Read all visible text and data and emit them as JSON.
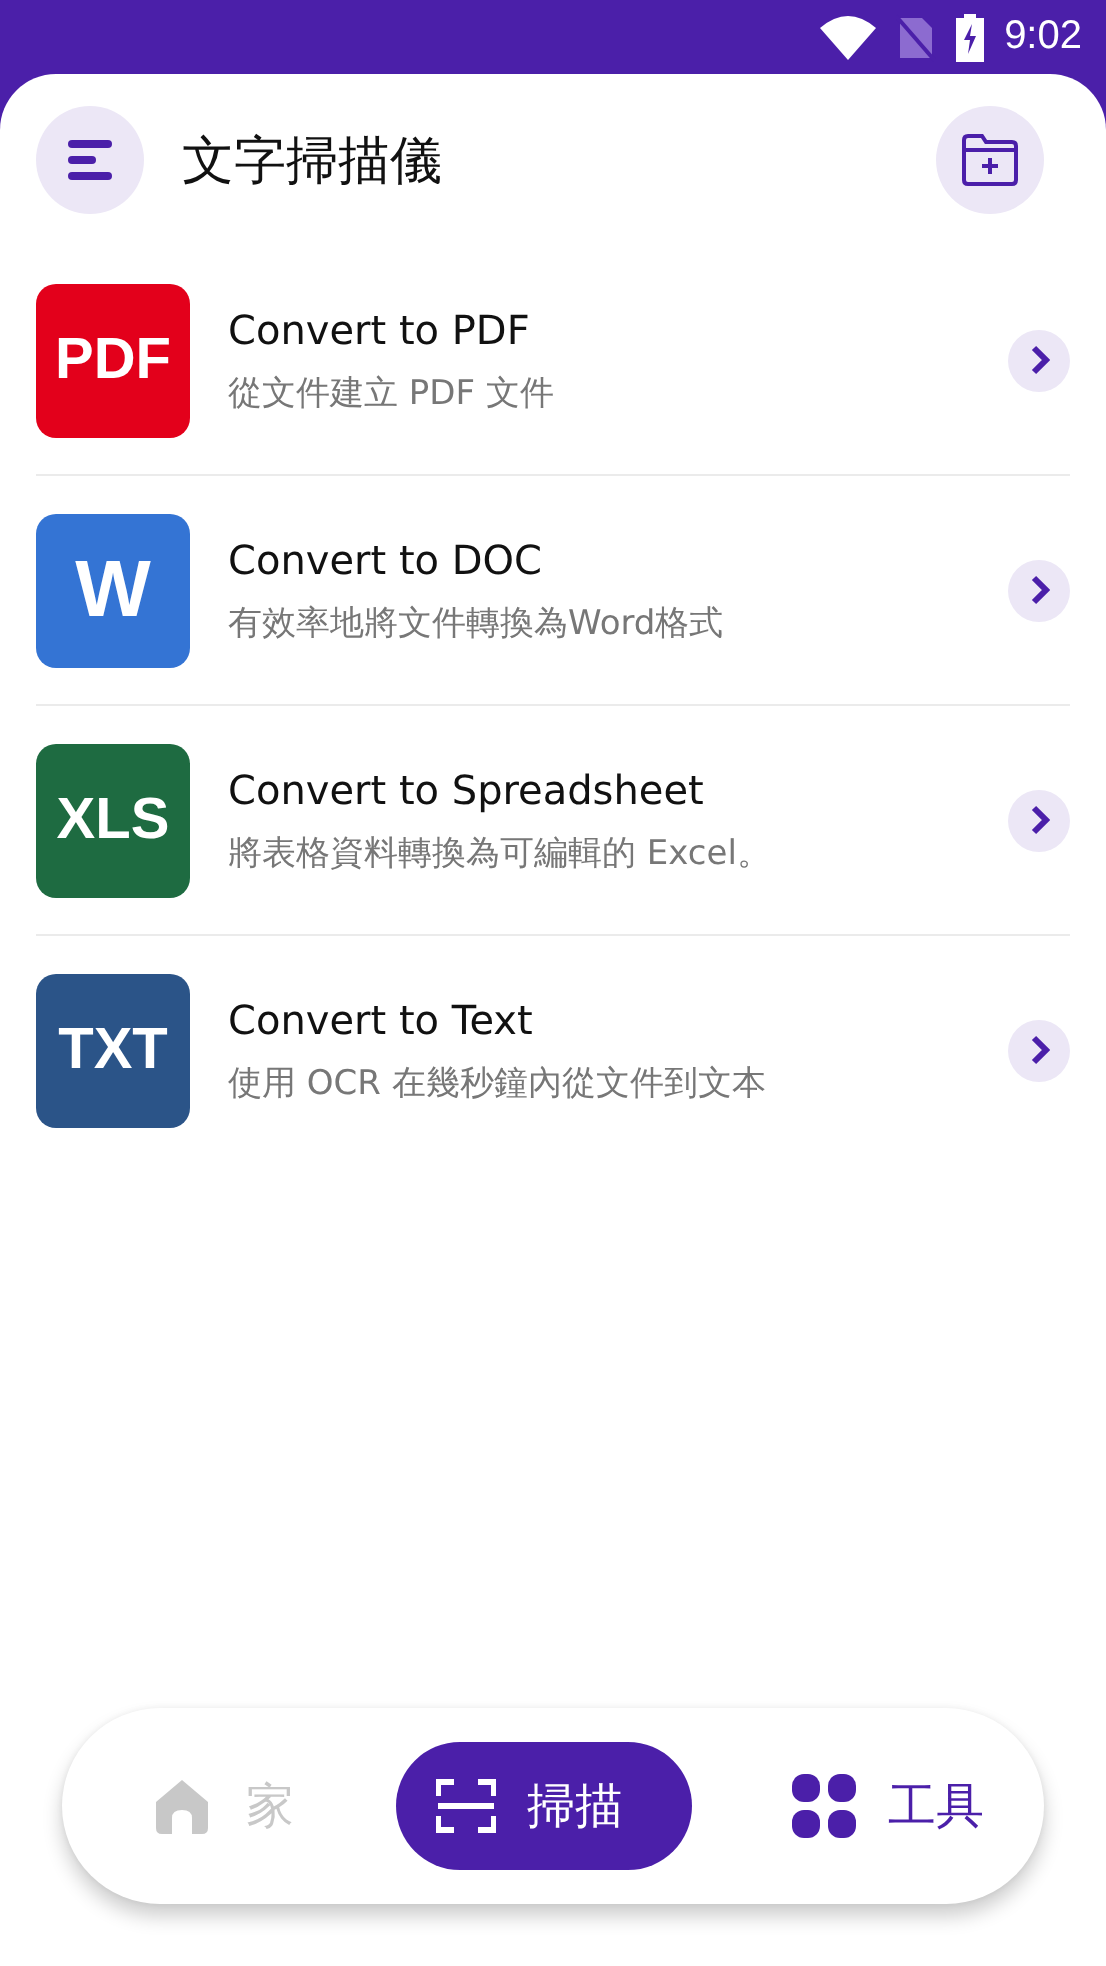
{
  "status_bar": {
    "time": "9:02"
  },
  "header": {
    "title": "文字掃描儀"
  },
  "tools": [
    {
      "badge": "PDF",
      "color": "#e3001b",
      "title": "Convert to PDF",
      "subtitle": "從文件建立 PDF 文件"
    },
    {
      "badge": "W",
      "color": "#3474d4",
      "title": "Convert to DOC",
      "subtitle": "有效率地將文件轉換為Word格式"
    },
    {
      "badge": "XLS",
      "color": "#1e6b41",
      "title": "Convert to Spreadsheet",
      "subtitle": "將表格資料轉換為可編輯的 Excel。"
    },
    {
      "badge": "TXT",
      "color": "#2b5488",
      "title": "Convert to Text",
      "subtitle": "使用 OCR 在幾秒鐘內從文件到文本"
    }
  ],
  "bottom_nav": [
    {
      "kind": "home",
      "label": "家",
      "selected": false,
      "disabled": true
    },
    {
      "kind": "scan",
      "label": "掃描",
      "selected": true,
      "disabled": false
    },
    {
      "kind": "tools",
      "label": "工具",
      "selected": false,
      "disabled": false
    }
  ]
}
